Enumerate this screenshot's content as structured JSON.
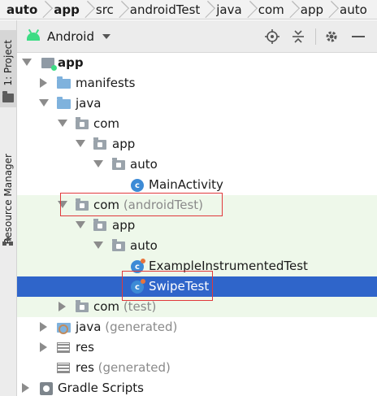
{
  "breadcrumb": {
    "items": [
      {
        "label": "auto",
        "bold": true
      },
      {
        "label": "app",
        "bold": true
      },
      {
        "label": "src",
        "bold": false
      },
      {
        "label": "androidTest",
        "bold": false
      },
      {
        "label": "java",
        "bold": false
      },
      {
        "label": "com",
        "bold": false
      },
      {
        "label": "app",
        "bold": false
      },
      {
        "label": "auto",
        "bold": false
      }
    ]
  },
  "side_strip": {
    "project_tab": "1: Project",
    "resource_tab": "Resource Manager"
  },
  "panel_header": {
    "view_selector": "Android",
    "icons": [
      "locate-icon",
      "collapse-all-icon",
      "gear-icon",
      "minimize-icon"
    ]
  },
  "tree": {
    "rows": [
      {
        "label": "app",
        "suffix": "",
        "icon": "module-icon",
        "expanded": true,
        "bold": true
      },
      {
        "label": "manifests",
        "suffix": "",
        "icon": "folder-icon",
        "expanded": false
      },
      {
        "label": "java",
        "suffix": "",
        "icon": "folder-icon",
        "expanded": true
      },
      {
        "label": "com",
        "suffix": "",
        "icon": "package-icon",
        "expanded": true
      },
      {
        "label": "app",
        "suffix": "",
        "icon": "package-icon",
        "expanded": true
      },
      {
        "label": "auto",
        "suffix": "",
        "icon": "package-icon",
        "expanded": true
      },
      {
        "label": "MainActivity",
        "suffix": "",
        "icon": "class-icon",
        "expanded": null
      },
      {
        "label": "com",
        "suffix": "(androidTest)",
        "icon": "package-icon",
        "expanded": true
      },
      {
        "label": "app",
        "suffix": "",
        "icon": "package-icon",
        "expanded": true
      },
      {
        "label": "auto",
        "suffix": "",
        "icon": "package-icon",
        "expanded": true
      },
      {
        "label": "ExampleInstrumentedTest",
        "suffix": "",
        "icon": "test-class-icon",
        "expanded": null
      },
      {
        "label": "SwipeTest",
        "suffix": "",
        "icon": "test-class-icon",
        "expanded": null,
        "selected": true
      },
      {
        "label": "com",
        "suffix": "(test)",
        "icon": "package-icon",
        "expanded": false
      },
      {
        "label": "java",
        "suffix": "(generated)",
        "icon": "generated-folder-icon",
        "expanded": false
      },
      {
        "label": "res",
        "suffix": "",
        "icon": "resource-folder-icon",
        "expanded": false
      },
      {
        "label": "res",
        "suffix": "(generated)",
        "icon": "resource-folder-icon",
        "expanded": null
      },
      {
        "label": "Gradle Scripts",
        "suffix": "",
        "icon": "gradle-icon",
        "expanded": false
      }
    ],
    "class_icon_letter": "c"
  },
  "colors": {
    "selection": "#2f65ca",
    "test_source_bg": "#eef8ea",
    "annotation_red": "#e0393b",
    "muted_text": "#8a8a8a"
  }
}
